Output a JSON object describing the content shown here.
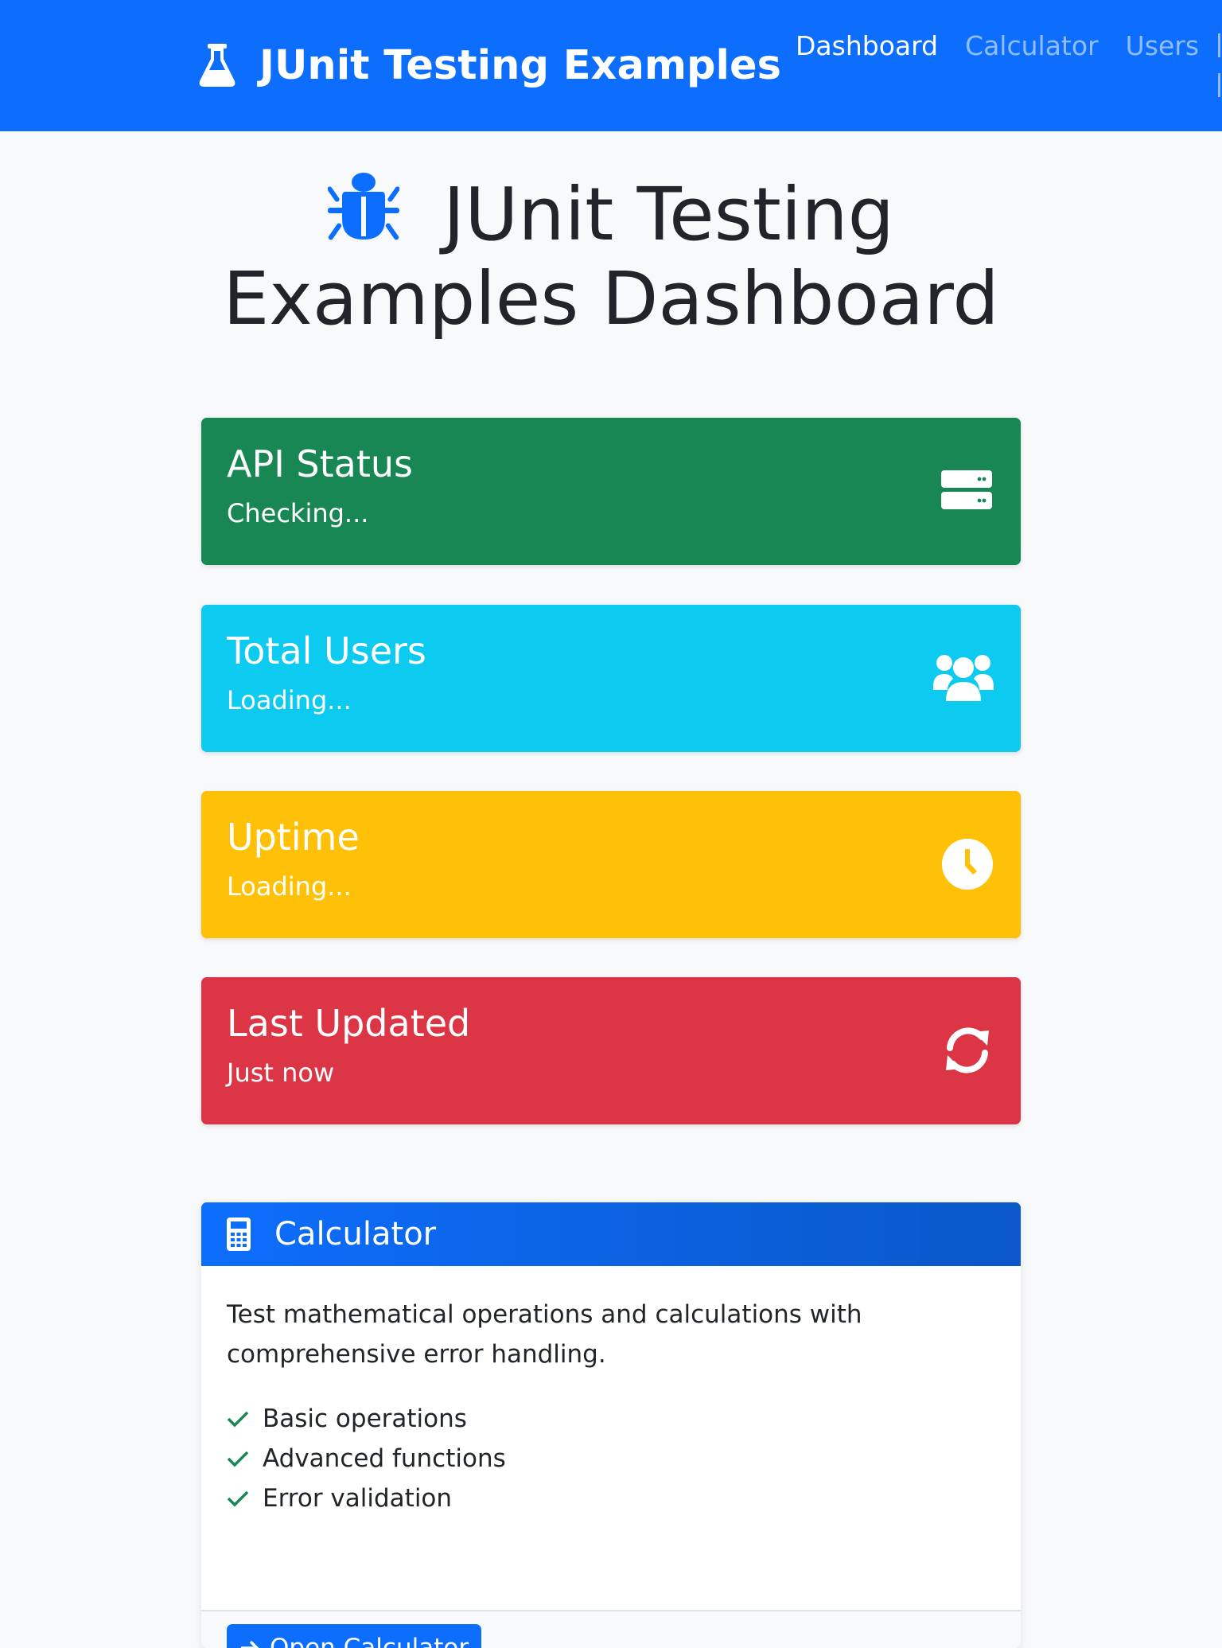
{
  "navbar": {
    "brand": "JUnit Testing Examples",
    "links": [
      "Dashboard",
      "Calculator",
      "Users"
    ],
    "active": "Dashboard",
    "brand_color": "#0d6efd"
  },
  "page": {
    "title": "JUnit Testing Examples Dashboard",
    "title_icon": "bug-icon"
  },
  "stats": {
    "api": {
      "title": "API Status",
      "value": "Checking...",
      "icon": "server-icon",
      "color": "#198754"
    },
    "users": {
      "title": "Total Users",
      "value": "Loading...",
      "icon": "users-icon",
      "color": "#0dcaf0"
    },
    "uptime": {
      "title": "Uptime",
      "value": "Loading...",
      "icon": "clock-icon",
      "color": "#ffc107"
    },
    "updated": {
      "title": "Last Updated",
      "value": "Just now",
      "icon": "sync-icon",
      "color": "#dc3545"
    }
  },
  "calculator_card": {
    "header": "Calculator",
    "icon": "calculator-icon",
    "description": "Test mathematical operations and calculations with comprehensive error handling.",
    "features": [
      "Basic operations",
      "Advanced functions",
      "Error validation"
    ],
    "button_label": "Open Calculator",
    "check_color": "#198754"
  }
}
